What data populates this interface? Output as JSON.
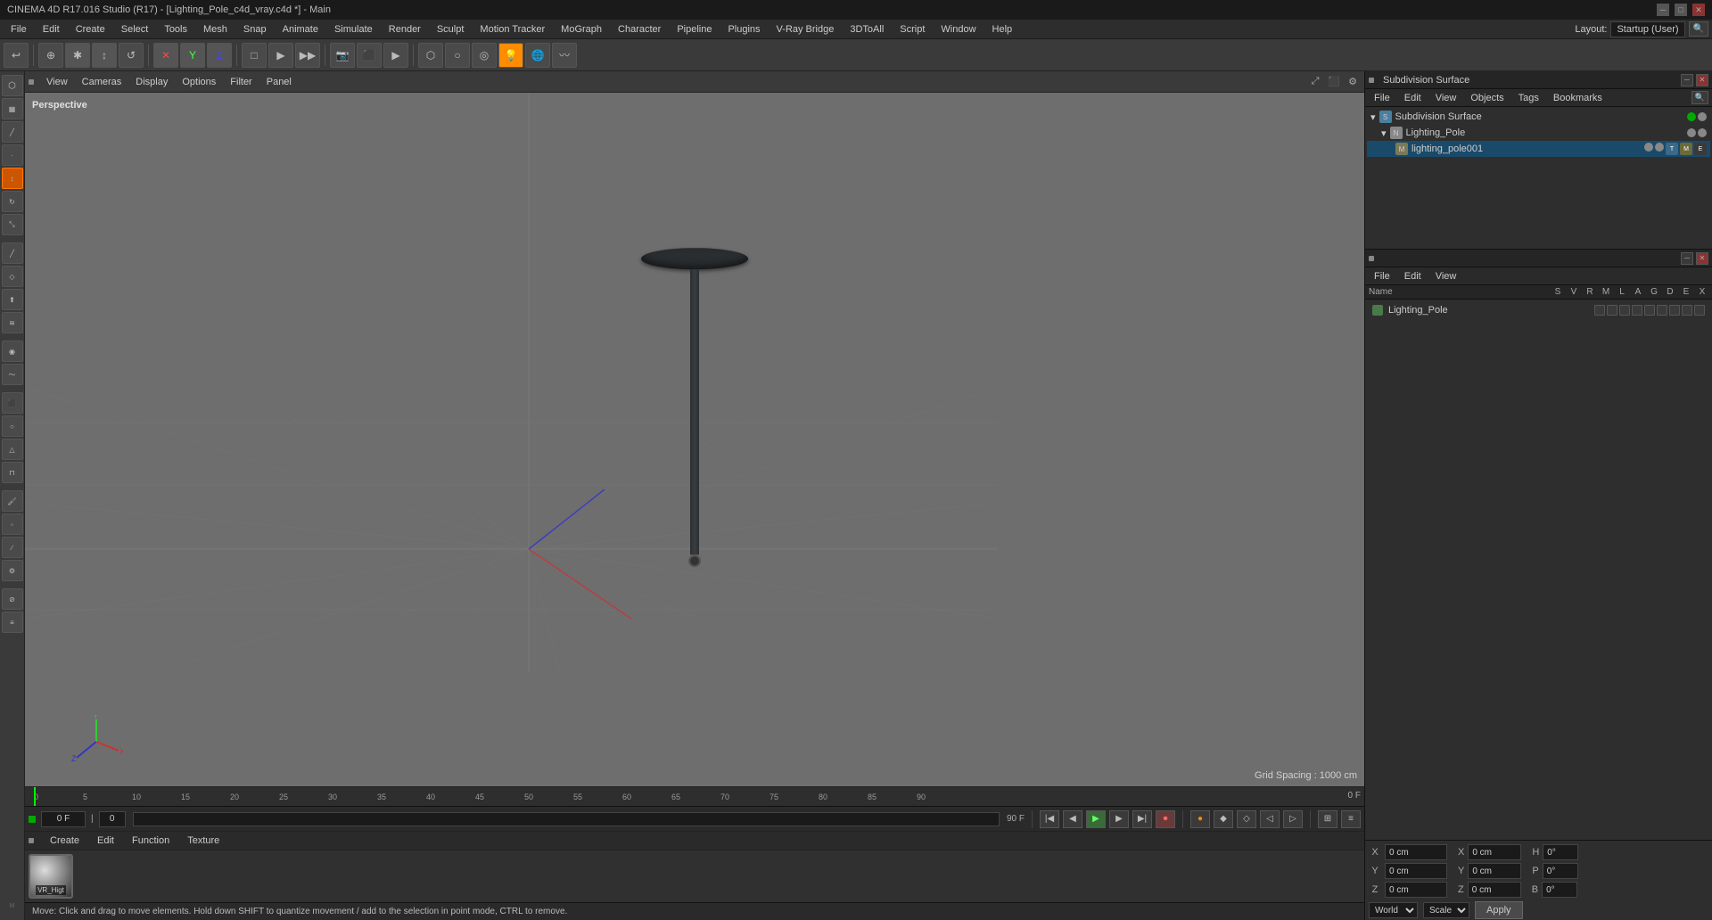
{
  "titlebar": {
    "title": "CINEMA 4D R17.016 Studio (R17) - [Lighting_Pole_c4d_vray.c4d *] - Main",
    "minimize": "─",
    "maximize": "□",
    "close": "✕"
  },
  "menubar": {
    "items": [
      "File",
      "Edit",
      "Create",
      "Select",
      "Tools",
      "Mesh",
      "Snap",
      "Animate",
      "Simulate",
      "Render",
      "Sculpt",
      "Motion Tracker",
      "MoGraph",
      "Character",
      "Pipeline",
      "Plugins",
      "V-Ray Bridge",
      "3DToAll",
      "Script",
      "Window",
      "Help"
    ]
  },
  "layout": {
    "label": "Layout:",
    "value": "Startup (User)"
  },
  "toolbar": {
    "buttons": [
      "↩",
      "",
      "⊕",
      "↺",
      "⊘",
      "✕",
      "⊕",
      "Z",
      "□",
      "▶",
      "▶▶",
      "📷",
      "🎬",
      "📽",
      "📸",
      "🎥",
      "●",
      "⬡",
      "○",
      "◎",
      "🔘",
      "🌐",
      "💡"
    ]
  },
  "viewport": {
    "perspective_label": "Perspective",
    "grid_spacing": "Grid Spacing : 1000 cm",
    "view_menu": "View",
    "cameras_menu": "Cameras",
    "display_menu": "Display",
    "options_menu": "Options",
    "filter_menu": "Filter",
    "panel_menu": "Panel"
  },
  "timeline": {
    "markers": [
      "0",
      "5",
      "10",
      "15",
      "20",
      "25",
      "30",
      "35",
      "40",
      "45",
      "50",
      "55",
      "60",
      "65",
      "70",
      "75",
      "80",
      "85",
      "90"
    ],
    "end_frame": "0 F"
  },
  "transport": {
    "current_frame": "0 F",
    "end_frame": "90 F",
    "frame_counter": "0"
  },
  "material_bar": {
    "menus": [
      "Create",
      "Edit",
      "Function",
      "Texture"
    ],
    "material": {
      "name": "VR_High",
      "label": "VR_Higt"
    }
  },
  "status_bar": {
    "text": "Move: Click and drag to move elements. Hold down SHIFT to quantize movement / add to the selection in point mode, CTRL to remove."
  },
  "object_manager": {
    "title": "Subdivision Surface",
    "menus": [
      "File",
      "Edit",
      "View",
      "Objects",
      "Tags",
      "Bookmarks"
    ],
    "objects": [
      {
        "name": "Subdivision Surface",
        "type": "subdivision",
        "indent": 0,
        "has_tag": false
      },
      {
        "name": "Lighting_Pole",
        "type": "null",
        "indent": 1,
        "has_tag": false
      },
      {
        "name": "lighting_pole001",
        "type": "mesh",
        "indent": 2,
        "has_tag": true
      }
    ]
  },
  "material_manager": {
    "menus": [
      "File",
      "Edit",
      "View"
    ],
    "columns": [
      "Name",
      "S",
      "V",
      "R",
      "M",
      "L",
      "A",
      "G",
      "D",
      "E",
      "X"
    ],
    "materials": [
      {
        "name": "Lighting_Pole",
        "color": "#4a7a4a"
      }
    ]
  },
  "coordinates": {
    "x_pos": "0 cm",
    "y_pos": "0 cm",
    "z_pos": "0 cm",
    "x_rot": "0 cm",
    "y_rot": "0 cm",
    "z_rot": "0 cm",
    "h_val": "0°",
    "p_val": "0°",
    "b_val": "0°",
    "space_label": "World",
    "scale_label": "Scale",
    "apply_label": "Apply"
  }
}
